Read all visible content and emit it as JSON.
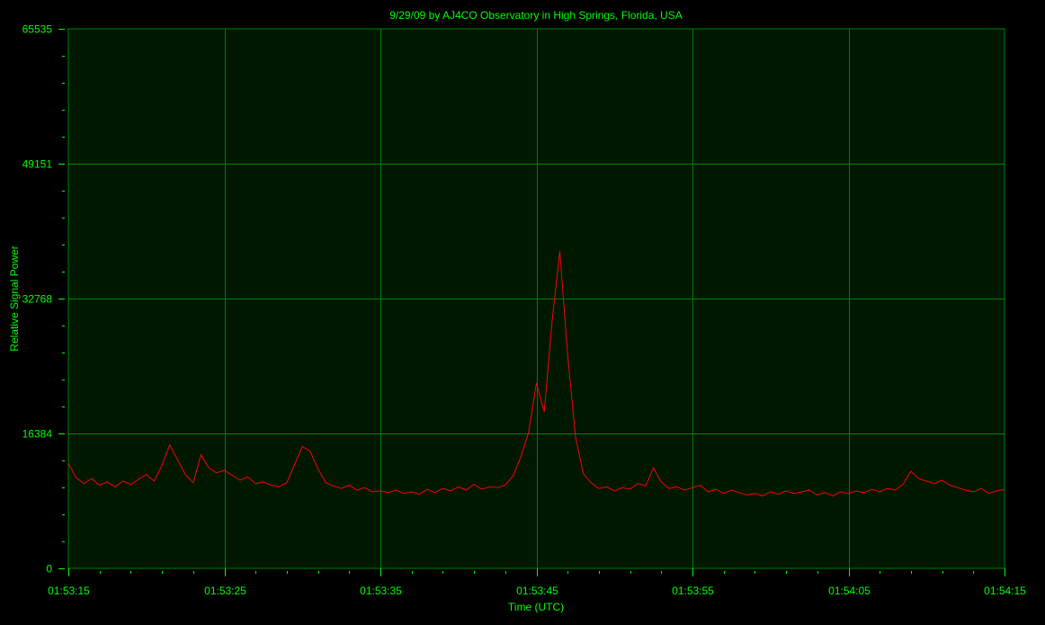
{
  "chart_data": {
    "type": "line",
    "title": "9/29/09  by  AJ4CO Observatory  in  High Springs, Florida, USA",
    "xlabel": "Time (UTC)",
    "ylabel": "Relative Signal Power",
    "ylim": [
      0,
      65535
    ],
    "xlim_seconds": [
      0,
      60
    ],
    "y_ticks": [
      0,
      16384,
      32768,
      49151,
      65535
    ],
    "y_tick_labels": [
      "0",
      "16384",
      "32768",
      "49151",
      "65535"
    ],
    "x_ticks_seconds": [
      0,
      10,
      20,
      30,
      40,
      50,
      60
    ],
    "x_tick_labels": [
      "01:53:15",
      "01:53:25",
      "01:53:35",
      "01:53:45",
      "01:53:55",
      "01:54:05",
      "01:54:15"
    ],
    "grid": true,
    "colors": {
      "background": "#000000",
      "plot_bg": "#001800",
      "grid": "#008000",
      "text": "#00ff00",
      "series": "#ff0000"
    },
    "series": [
      {
        "name": "Relative Signal Power",
        "x_step_seconds": 0.5,
        "values": [
          12800,
          11000,
          10300,
          10900,
          10100,
          10500,
          9900,
          10600,
          10200,
          10800,
          11400,
          10600,
          12500,
          15000,
          13200,
          11400,
          10400,
          13800,
          12200,
          11600,
          11900,
          11300,
          10700,
          11100,
          10300,
          10500,
          10100,
          9900,
          10400,
          12600,
          14800,
          14200,
          12100,
          10400,
          10000,
          9700,
          10100,
          9500,
          9800,
          9300,
          9400,
          9200,
          9500,
          9100,
          9300,
          9000,
          9600,
          9200,
          9700,
          9400,
          9900,
          9500,
          10200,
          9600,
          9900,
          9800,
          10100,
          11200,
          13500,
          16500,
          22500,
          19000,
          30000,
          38500,
          26000,
          16000,
          11500,
          10400,
          9700,
          9900,
          9400,
          9800,
          9600,
          10300,
          10000,
          12200,
          10500,
          9700,
          9900,
          9500,
          9800,
          10100,
          9300,
          9600,
          9100,
          9500,
          9200,
          8900,
          9100,
          8800,
          9300,
          9000,
          9400,
          9100,
          9300,
          9500,
          8900,
          9200,
          8800,
          9300,
          9100,
          9400,
          9200,
          9600,
          9300,
          9700,
          9500,
          10200,
          11800,
          10900,
          10600,
          10300,
          10700,
          10100,
          9800,
          9500,
          9300,
          9700,
          9100,
          9400,
          9600
        ]
      }
    ]
  }
}
